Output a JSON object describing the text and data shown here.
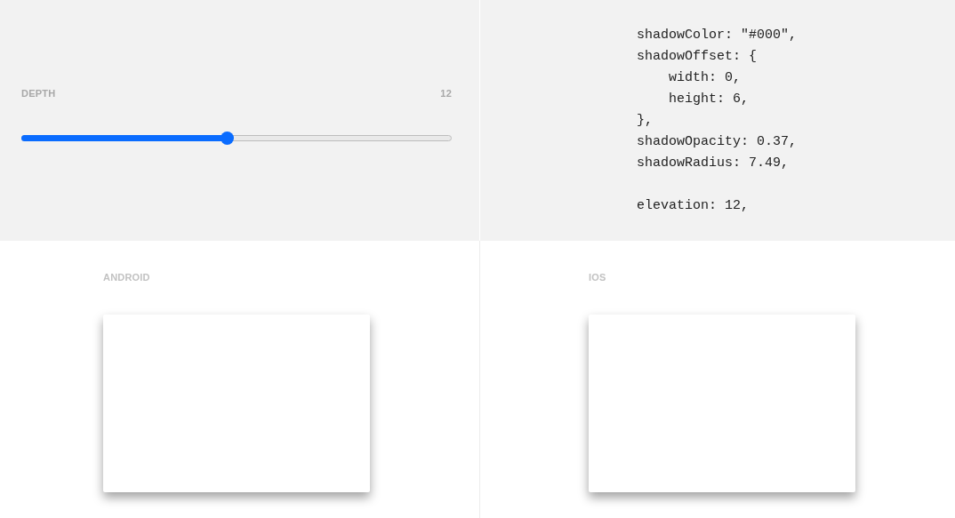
{
  "depth": {
    "label": "DEPTH",
    "value": "12",
    "level": 0.48
  },
  "code": {
    "blocks": [
      [
        "shadowColor: \"#000\",",
        "shadowOffset: {",
        "    width: 0,",
        "    height: 6,",
        "},",
        "shadowOpacity: 0.37,",
        "shadowRadius: 7.49,"
      ],
      [
        "elevation: 12,"
      ]
    ]
  },
  "previews": [
    {
      "label": "ANDROID"
    },
    {
      "label": "IOS"
    }
  ]
}
